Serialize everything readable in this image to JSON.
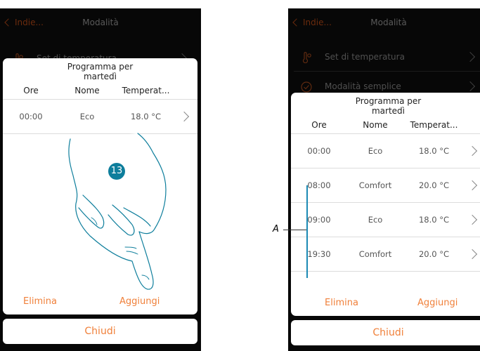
{
  "left": {
    "back_label": "Indie...",
    "title": "Modalità",
    "bg_item_label": "Set di temperatura",
    "dialog": {
      "title_line1": "Programma per",
      "title_line2": "martedì",
      "columns": [
        "Ore",
        "Nome",
        "Temperat..."
      ],
      "rows": [
        {
          "time": "00:00",
          "name": "Eco",
          "temp": "18.0 °C"
        }
      ],
      "delete_label": "Elimina",
      "add_label": "Aggiungi"
    },
    "close_label": "Chiudi",
    "step_number": "13"
  },
  "right": {
    "back_label": "Indie...",
    "title": "Modalità",
    "bg_items": [
      {
        "label": "Set di temperatura",
        "icon": "thermometer-icon"
      },
      {
        "label": "Modalità semplice",
        "icon": "check-circle-icon"
      }
    ],
    "dialog": {
      "title_line1": "Programma per",
      "title_line2": "martedì",
      "columns": [
        "Ore",
        "Nome",
        "Temperat..."
      ],
      "rows": [
        {
          "time": "00:00",
          "name": "Eco",
          "temp": "18.0 °C"
        },
        {
          "time": "08:00",
          "name": "Comfort",
          "temp": "20.0 °C"
        },
        {
          "time": "09:00",
          "name": "Eco",
          "temp": "18.0 °C"
        },
        {
          "time": "19:30",
          "name": "Comfort",
          "temp": "20.0 °C"
        }
      ],
      "delete_label": "Elimina",
      "add_label": "Aggiungi"
    },
    "close_label": "Chiudi"
  },
  "annotation_label": "A",
  "colors": {
    "accent": "#f0803a",
    "badge": "#0e7e9c",
    "annotation_bar": "#1b8ab4"
  }
}
